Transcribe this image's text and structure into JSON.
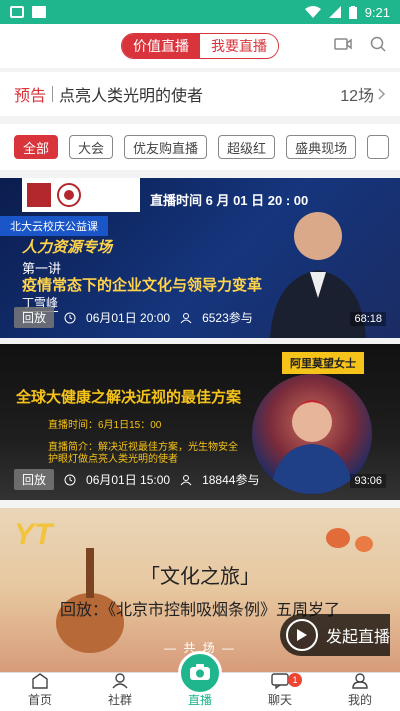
{
  "status_bar": {
    "time": "9:21"
  },
  "header": {
    "tabs": [
      {
        "label": "价值直播",
        "active": true
      },
      {
        "label": "我要直播",
        "active": false
      }
    ]
  },
  "notice": {
    "tag": "预告",
    "title": "点亮人类光明的使者",
    "count": "12场"
  },
  "filters": [
    {
      "label": "全部",
      "active": true
    },
    {
      "label": "大会"
    },
    {
      "label": "优友购直播"
    },
    {
      "label": "超级红"
    },
    {
      "label": "盛典现场"
    }
  ],
  "cards": [
    {
      "live_time": "直播时间 6 月 01 日 20 : 00",
      "ribbon": "北大云校庆公益课",
      "series": "人力资源专场",
      "lecture": "第一讲",
      "title": "疫情常态下的企业文化与领导力变革",
      "speaker": "丁雪峰",
      "replay_label": "回放",
      "date": "06月01日 20:00",
      "participants": "6523参与",
      "duration": "68:18"
    },
    {
      "tagline": "全球大健康之解决近视的最佳方案",
      "live_time": "直播时间：6月1日15：00",
      "desc_line1": "直播简介：解决近视最佳方案，光生物安全",
      "desc_line2": "护眼灯做点亮人类光明的使者",
      "badge": "阿里莫望女士",
      "replay_label": "回放",
      "date": "06月01日 15:00",
      "participants": "18844参与",
      "duration": "93:06"
    },
    {
      "logo": "YT",
      "title": "「文化之旅」",
      "subtitle": "回放：《北京市控制吸烟条例》五周岁了",
      "footer": "— 共 场 —"
    }
  ],
  "fab": {
    "label": "发起直播"
  },
  "tabbar": [
    {
      "label": "首页",
      "icon": "home-icon"
    },
    {
      "label": "社群",
      "icon": "community-icon"
    },
    {
      "label": "直播",
      "icon": "camera-icon",
      "active": true
    },
    {
      "label": "聊天",
      "icon": "chat-icon",
      "badge": "1"
    },
    {
      "label": "我的",
      "icon": "profile-icon"
    }
  ],
  "colors": {
    "brand_red": "#d9333b",
    "brand_green": "#1fb58d"
  }
}
